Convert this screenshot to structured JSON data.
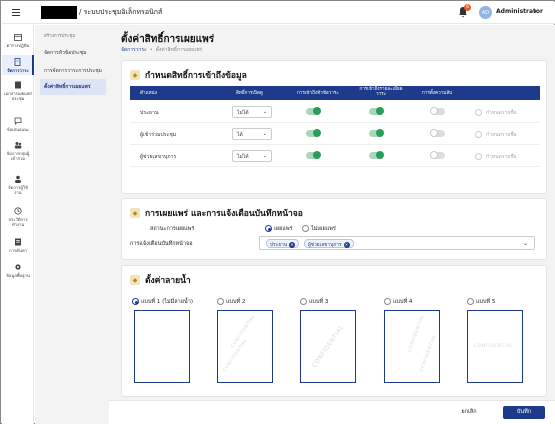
{
  "header": {
    "app_title": "/ ระบบประชุมอิเล็กทรอนิกส์",
    "notification_count": "6",
    "avatar_initials": "AD",
    "user_name": "Administrator"
  },
  "sidebar": {
    "items": [
      {
        "label": "ตารางปฏิทิน",
        "icon": "calendar-icon"
      },
      {
        "label": "จัดการวาระ",
        "icon": "document-edit-icon"
      },
      {
        "label": "เอกสารเผยแพร่\nประชุม",
        "icon": "book-icon"
      },
      {
        "label": "ข้อเสนอแนะ",
        "icon": "chat-icon"
      },
      {
        "label": "จัดการกลุ่มผู้\nเข้าร่วม",
        "icon": "group-icon"
      },
      {
        "label": "จัดการผู้ใช้\nงาน",
        "icon": "user-icon"
      },
      {
        "label": "ประวัติการ\nทำงาน",
        "icon": "history-icon"
      },
      {
        "label": "การค้นหา",
        "icon": "search-doc-icon"
      },
      {
        "label": "ข้อมูลพื้นฐาน",
        "icon": "gear-icon"
      }
    ]
  },
  "subnav": {
    "heading": "สร้างการประชุม",
    "items": [
      "จัดการหัวข้อประชุม",
      "การจัดการวาระการประชุม",
      "ตั้งค่าสิทธิ์การเผยแพร่"
    ]
  },
  "page": {
    "title": "ตั้งค่าสิทธิ์การเผยแพร่",
    "breadcrumb": [
      "จัดการวาระ",
      "ตั้งค่าสิทธิ์การเผยแพร่"
    ]
  },
  "access": {
    "title": "กำหนดสิทธิ์การเข้าถึงข้อมูล",
    "columns": [
      "ตำแหน่ง",
      "สิทธิ์การเปิดดู",
      "การเข้าถึงหัวข้อวาระ",
      "การเข้าถึงรายละเอียด\nวาระ",
      "การตั้งความลับ",
      ""
    ],
    "rows": [
      {
        "position": "ประธาน",
        "view": "ไม่ได้",
        "topic": true,
        "detail": true,
        "secret": false,
        "assign": "กำหนดรายชื่อ"
      },
      {
        "position": "ผู้เข้าร่วมประชุม",
        "view": "ได้",
        "topic": true,
        "detail": true,
        "secret": false,
        "assign": "กำหนดรายชื่อ"
      },
      {
        "position": "ผู้ช่วยเลขานุการ",
        "view": "ไม่ได้",
        "topic": true,
        "detail": true,
        "secret": false,
        "assign": "กำหนดรายชื่อ"
      }
    ]
  },
  "publish": {
    "title": "การเผยแพร่ และการแจ้งเตือนบันทึกหน้าจอ",
    "status_label": "สถานะการเผยแพร่",
    "options": [
      "เผยแพร่",
      "ไม่เผยแพร่"
    ],
    "selected": 0,
    "notify_label": "การแจ้งเตือนบันทึกหน้าจอ",
    "chips": [
      "ประธาน",
      "ผู้ช่วยเลขานุการ"
    ]
  },
  "watermark": {
    "title": "ตั้งค่าลายน้ำ",
    "options": [
      "แบบที่ 1 (ไม่มีลายน้ำ)",
      "แบบที่ 2",
      "แบบที่ 3",
      "แบบที่ 4",
      "แบบที่ 5"
    ],
    "selected": 0,
    "sample_text": "CONFIDENTIAL"
  },
  "footer": {
    "cancel": "ยกเลิก",
    "save": "บันทึก"
  },
  "colors": {
    "primary": "#1e3a8a",
    "toggle_on": "#2a9d5c",
    "badge": "#e85c2a"
  }
}
